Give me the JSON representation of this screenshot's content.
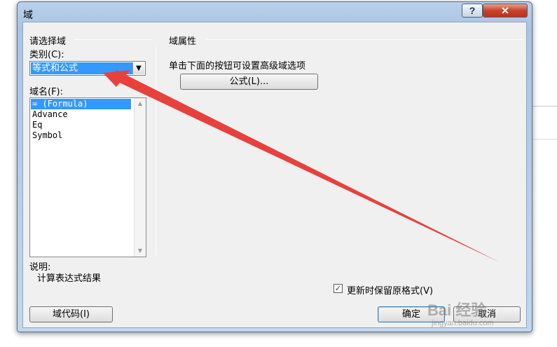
{
  "window": {
    "title": "域",
    "help_label": "?",
    "close_label": "✕"
  },
  "left_panel": {
    "group_title": "请选择域",
    "category_label": "类别(C):",
    "category_value": "等式和公式",
    "field_name_label": "域名(F):",
    "field_names": [
      "= (Formula)",
      "Advance",
      "Eq",
      "Symbol"
    ],
    "selected_index": 0,
    "description_title": "说明:",
    "description_text": "计算表达式结果"
  },
  "right_panel": {
    "group_title": "域属性",
    "instruction": "单击下面的按钮可设置高级域选项",
    "formula_button": "公式(L)...",
    "preserve_format_label": "更新时保留原格式(V)",
    "preserve_format_checked": true
  },
  "footer": {
    "field_codes_button": "域代码(I)",
    "ok_button": "确定",
    "cancel_button": "取消"
  },
  "annotation": {
    "arrow_color": "#e8413c"
  },
  "watermark": {
    "main": "Bai 经验",
    "sub": "jingyan.baidu.com"
  }
}
